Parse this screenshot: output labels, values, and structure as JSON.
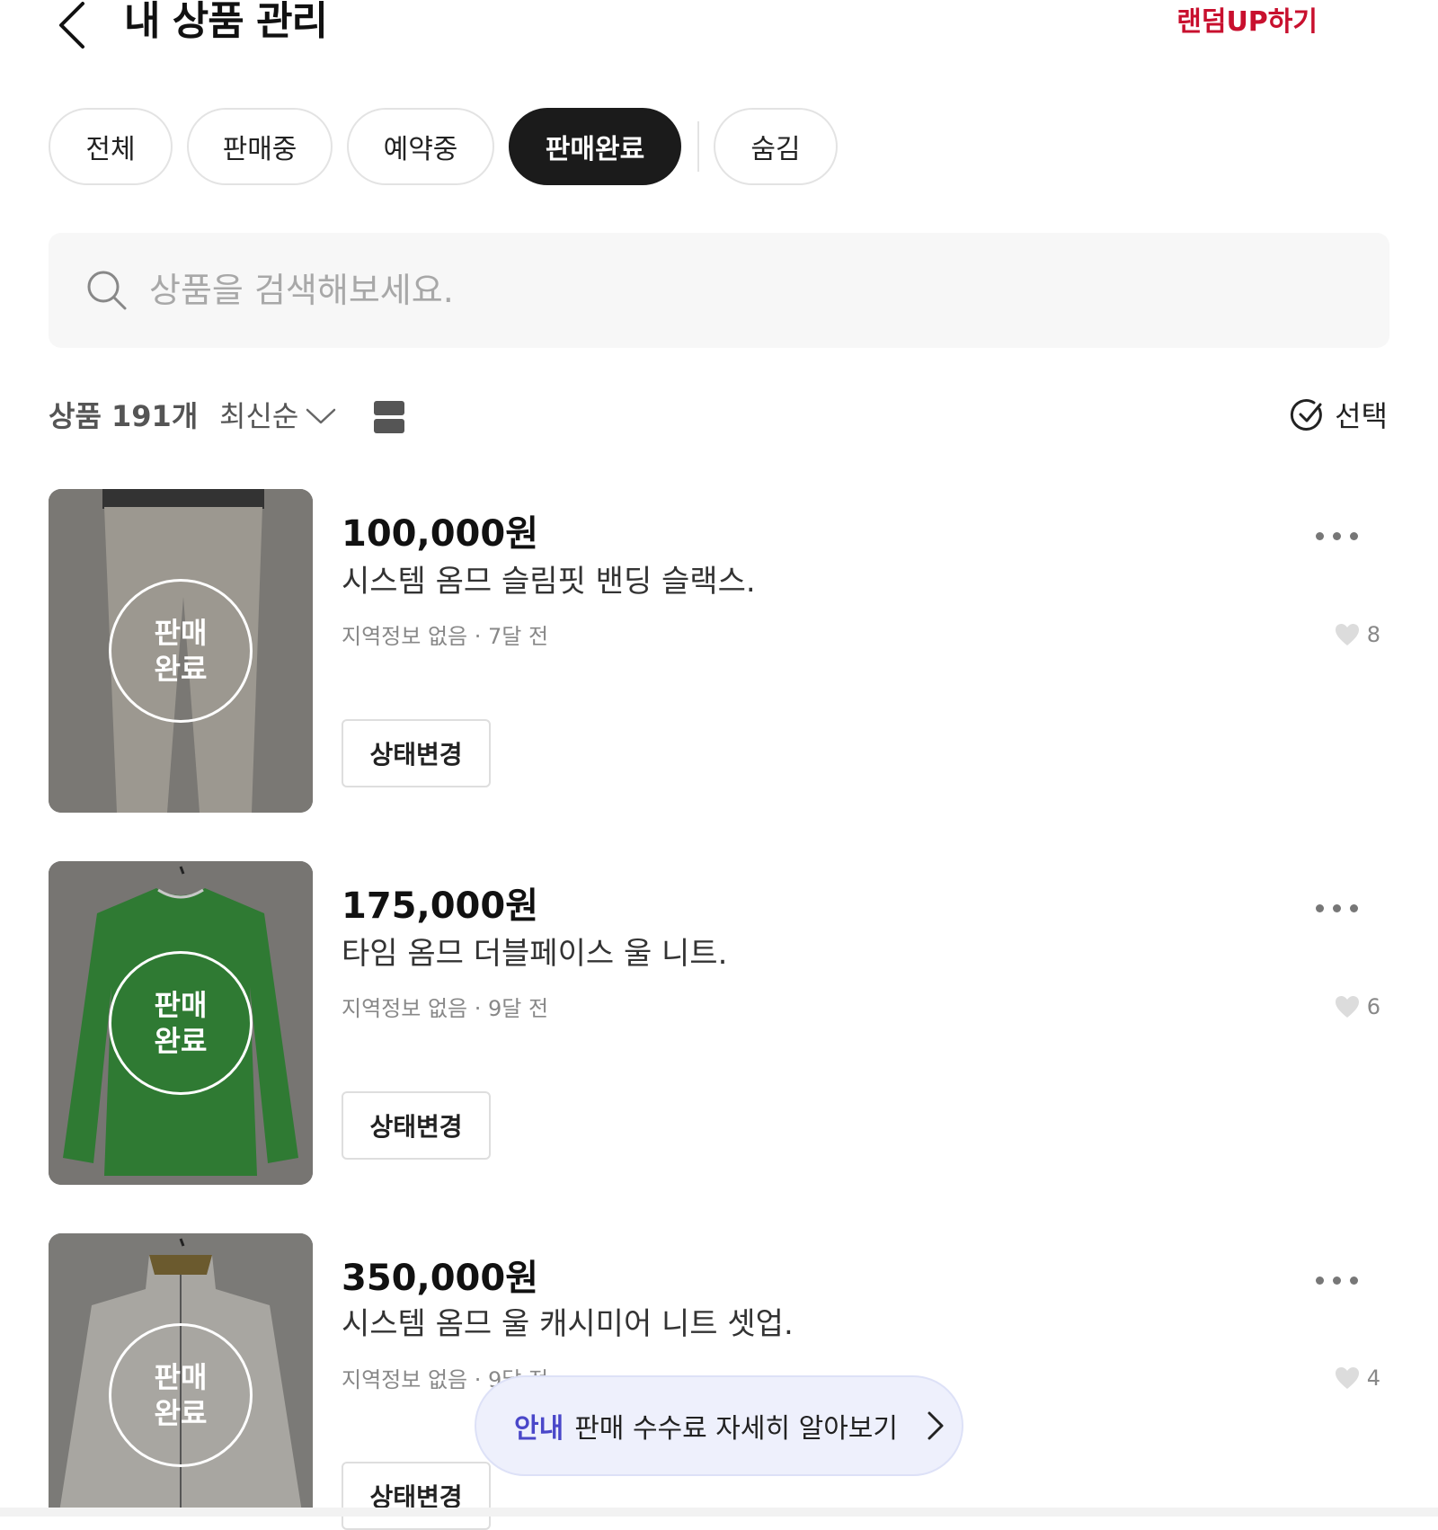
{
  "header": {
    "title": "내 상품 관리",
    "random_up": "랜덤UP하기"
  },
  "filters": [
    {
      "label": "전체",
      "active": false
    },
    {
      "label": "판매중",
      "active": false
    },
    {
      "label": "예약중",
      "active": false
    },
    {
      "label": "판매완료",
      "active": true
    },
    {
      "label": "숨김",
      "active": false
    }
  ],
  "search": {
    "placeholder": "상품을 검색해보세요."
  },
  "toolbar": {
    "count": "상품 191개",
    "sort": "최신순",
    "select": "선택"
  },
  "products": [
    {
      "price": "100,000원",
      "title": "시스템 옴므 슬림핏 밴딩 슬랙스.",
      "location": "지역정보 없음",
      "time": "7달 전",
      "likes": "8",
      "sold_badge": "판매\n완료",
      "status_button": "상태변경",
      "item_color": "#c9c4bc"
    },
    {
      "price": "175,000원",
      "title": "타임 옴므 더블페이스 울 니트.",
      "location": "지역정보 없음",
      "time": "9달 전",
      "likes": "6",
      "sold_badge": "판매\n완료",
      "status_button": "상태변경",
      "item_color": "#2e7d32"
    },
    {
      "price": "350,000원",
      "title": "시스템 옴므 울 캐시미어 니트 셋업.",
      "location": "지역정보 없음",
      "time": "9달 전",
      "likes": "4",
      "sold_badge": "판매\n완료",
      "status_button": "상태변경",
      "item_color": "#d8d6d0"
    }
  ],
  "notice": {
    "tag": "안내",
    "text": "판매 수수료 자세히 알아보기"
  },
  "colors": {
    "accent_red": "#c8102e",
    "notice_tag": "#4a47c9",
    "chip_active_bg": "#1b1b1b"
  }
}
